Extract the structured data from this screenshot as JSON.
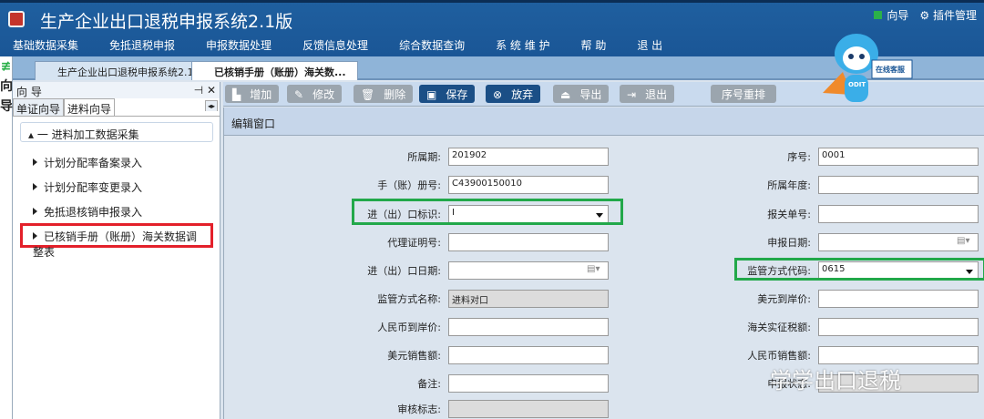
{
  "app": {
    "title": "生产企业出口退税申报系统2.1版",
    "guide": "向导",
    "plugins": "插件管理"
  },
  "menu": [
    "基础数据采集",
    "免抵退税申报",
    "申报数据处理",
    "反馈信息处理",
    "综合数据查询",
    "系 统 维 护",
    "帮 助",
    "退 出"
  ],
  "tabs": [
    "生产企业出口退税申报系统2.1版",
    "已核销手册（账册）海关数..."
  ],
  "vstrip": [
    "向",
    "导"
  ],
  "leftpanel": {
    "title": "向 导",
    "tabs": [
      "单证向导",
      "进料向导"
    ],
    "tree_head": "一  进料加工数据采集",
    "items": [
      "计划分配率备案录入",
      "计划分配率变更录入",
      "免抵退核销申报录入",
      "已核销手册（账册）海关数据调整表"
    ]
  },
  "toolbar": [
    "增加",
    "修改",
    "删除",
    "保存",
    "放弃",
    "导出",
    "退出",
    "序号重排"
  ],
  "mascot": {
    "badge": "在线客服",
    "tag": "ODIT"
  },
  "editor": {
    "title": "编辑窗口",
    "left": [
      {
        "label": "所属期:",
        "value": "201902"
      },
      {
        "label": "手（账）册号:",
        "value": "C43900150010"
      },
      {
        "label": "进（出）口标识:",
        "value": "I"
      },
      {
        "label": "代理证明号:",
        "value": ""
      },
      {
        "label": "进（出）口日期:",
        "value": ""
      },
      {
        "label": "监管方式名称:",
        "value": "进料对口"
      },
      {
        "label": "人民币到岸价:",
        "value": ""
      },
      {
        "label": "美元销售额:",
        "value": ""
      },
      {
        "label": "备注:",
        "value": ""
      },
      {
        "label": "审核标志:",
        "value": ""
      }
    ],
    "right": [
      {
        "label": "序号:",
        "value": "0001"
      },
      {
        "label": "所属年度:",
        "value": ""
      },
      {
        "label": "报关单号:",
        "value": ""
      },
      {
        "label": "申报日期:",
        "value": ""
      },
      {
        "label": "监管方式代码:",
        "value": "0615"
      },
      {
        "label": "美元到岸价:",
        "value": ""
      },
      {
        "label": "海关实征税额:",
        "value": ""
      },
      {
        "label": "人民币销售额:",
        "value": ""
      },
      {
        "label": "申报状态:",
        "value": ""
      }
    ]
  },
  "watermark": "学学出口退税"
}
